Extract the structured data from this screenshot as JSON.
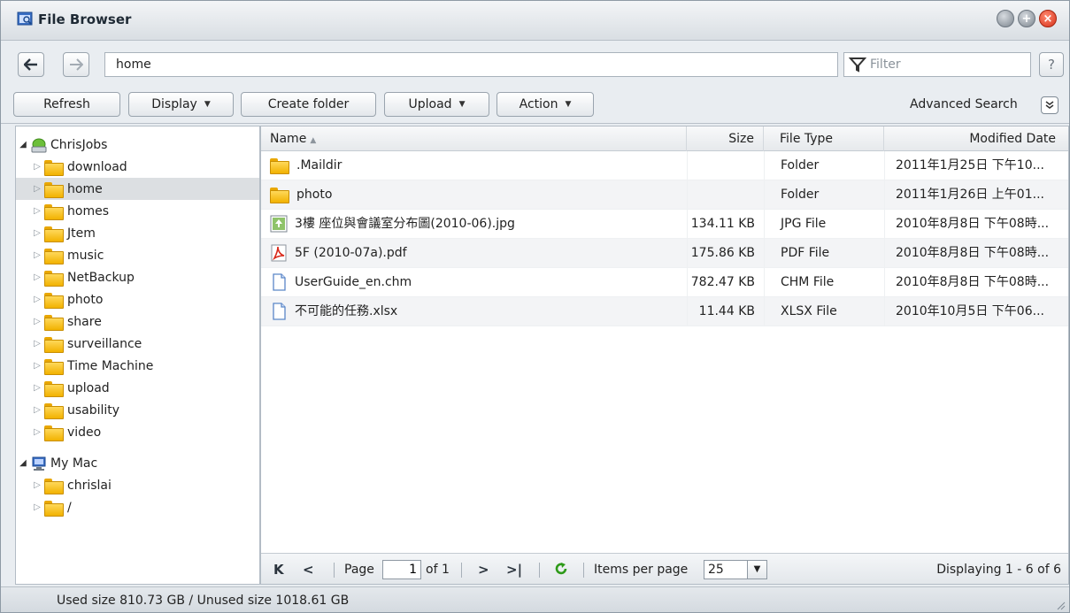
{
  "window": {
    "title": "File Browser"
  },
  "address": {
    "path": "home",
    "filter_placeholder": "Filter",
    "help": "?"
  },
  "toolbar": {
    "refresh": "Refresh",
    "display": "Display",
    "create_folder": "Create folder",
    "upload": "Upload",
    "action": "Action",
    "advanced_search": "Advanced Search"
  },
  "tree": {
    "server": {
      "label": "ChrisJobs",
      "children": [
        "download",
        "home",
        "homes",
        "Jtem",
        "music",
        "NetBackup",
        "photo",
        "share",
        "surveillance",
        "Time Machine",
        "upload",
        "usability",
        "video"
      ],
      "selected": "home"
    },
    "local": {
      "label": "My Mac",
      "children": [
        "chrislai",
        "/"
      ]
    }
  },
  "list": {
    "columns": {
      "name": "Name",
      "size": "Size",
      "type": "File Type",
      "date": "Modified Date"
    },
    "rows": [
      {
        "icon": "folder-icon",
        "name": ".Maildir",
        "size": "",
        "type": "Folder",
        "date": "2011年1月25日 下午10..."
      },
      {
        "icon": "folder-icon",
        "name": "photo",
        "size": "",
        "type": "Folder",
        "date": "2011年1月26日 上午01..."
      },
      {
        "icon": "image-file-icon",
        "name": "3樓 座位與會議室分布圖(2010-06).jpg",
        "size": "134.11 KB",
        "type": "JPG File",
        "date": "2010年8月8日 下午08時..."
      },
      {
        "icon": "pdf-file-icon",
        "name": "5F (2010-07a).pdf",
        "size": "175.86 KB",
        "type": "PDF File",
        "date": "2010年8月8日 下午08時..."
      },
      {
        "icon": "document-file-icon",
        "name": "UserGuide_en.chm",
        "size": "782.47 KB",
        "type": "CHM File",
        "date": "2010年8月8日 下午08時..."
      },
      {
        "icon": "document-file-icon",
        "name": "不可能的任務.xlsx",
        "size": "11.44 KB",
        "type": "XLSX File",
        "date": "2010年10月5日 下午06..."
      }
    ]
  },
  "pager": {
    "page_label": "Page",
    "page_value": "1",
    "of_label": "of 1",
    "items_per_page_label": "Items per page",
    "items_per_page_value": "25",
    "displaying": "Displaying 1 - 6 of 6"
  },
  "status": {
    "text": "Used size 810.73 GB / Unused size 1018.61 GB"
  },
  "colors": {
    "folder": "#f2b200",
    "close_button": "#d6301a",
    "selected_row": "#dcdfe2"
  }
}
